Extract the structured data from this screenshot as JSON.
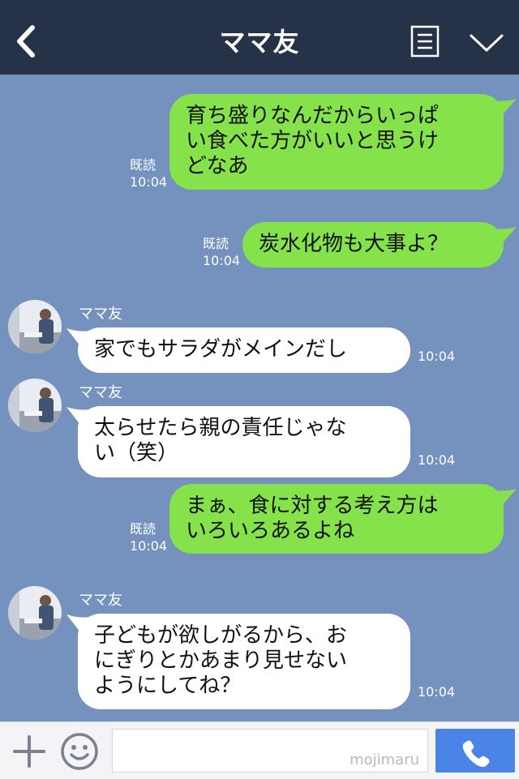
{
  "header": {
    "title": "ママ友"
  },
  "contact_name": "ママ友",
  "messages": [
    {
      "side": "right",
      "text": "育ち盛りなんだからいっぱ\nい食べた方がいいと思うけ\nどなあ",
      "read": "既読",
      "time": "10:04"
    },
    {
      "side": "right",
      "text": "炭水化物も大事よ？",
      "read": "既読",
      "time": "10:04"
    },
    {
      "side": "left",
      "sender": "ママ友",
      "text": "家でもサラダがメインだし",
      "time": "10:04"
    },
    {
      "side": "left",
      "sender": "ママ友",
      "text": "太らせたら親の責任じゃな\nい（笑）",
      "time": "10:04"
    },
    {
      "side": "right",
      "text": "まぁ、食に対する考え方は\nいろいろあるよね",
      "read": "既読",
      "time": "10:04"
    },
    {
      "side": "left",
      "sender": "ママ友",
      "text": "子どもが欲しがるから、お\nにぎりとかあまり見せない\nようにしてね？",
      "time": "10:04"
    }
  ],
  "footer": {
    "watermark": "mojimaru"
  },
  "colors": {
    "background": "#7592bf",
    "header": "#263248",
    "green_bubble": "#86e24b",
    "call_button": "#4a84e6"
  }
}
